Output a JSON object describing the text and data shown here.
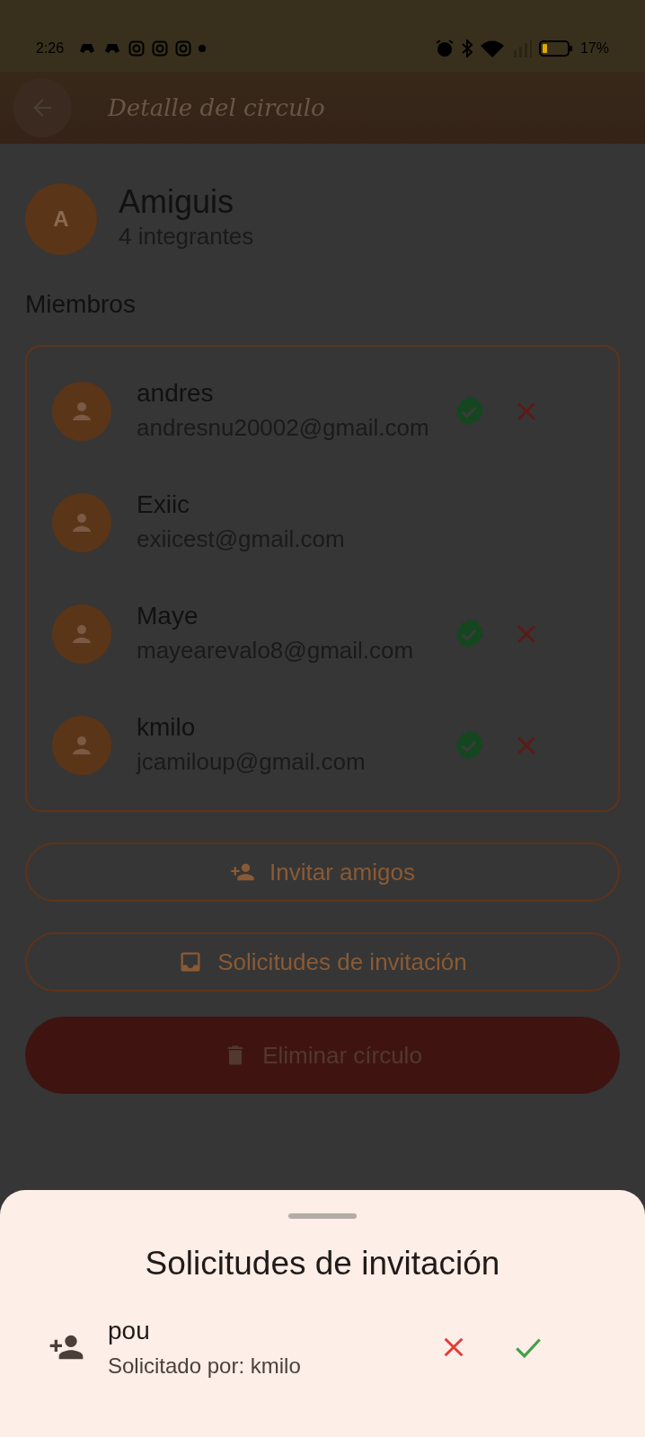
{
  "status_bar": {
    "time": "2:26",
    "battery": "17%"
  },
  "app_bar": {
    "title": "Detalle del circulo"
  },
  "circle": {
    "initial": "A",
    "name": "Amiguis",
    "count": "4 integrantes"
  },
  "members_title": "Miembros",
  "members": [
    {
      "name": "andres",
      "email": "andresnu20002@gmail.com",
      "verified": true
    },
    {
      "name": "Exiic",
      "email": "exiicest@gmail.com",
      "verified": false
    },
    {
      "name": "Maye",
      "email": "mayearevalo8@gmail.com",
      "verified": true
    },
    {
      "name": "kmilo",
      "email": "jcamiloup@gmail.com",
      "verified": true
    }
  ],
  "buttons": [
    {
      "kind": "outline",
      "label": "Invitar amigos"
    },
    {
      "kind": "outline",
      "label": "Solicitudes de invitación"
    },
    {
      "kind": "danger",
      "label": "Eliminar círculo"
    }
  ],
  "sheet": {
    "title": "Solicitudes de invitación",
    "requests": [
      {
        "name": "pou",
        "requested_by": "Solicitado por: kmilo"
      }
    ]
  }
}
